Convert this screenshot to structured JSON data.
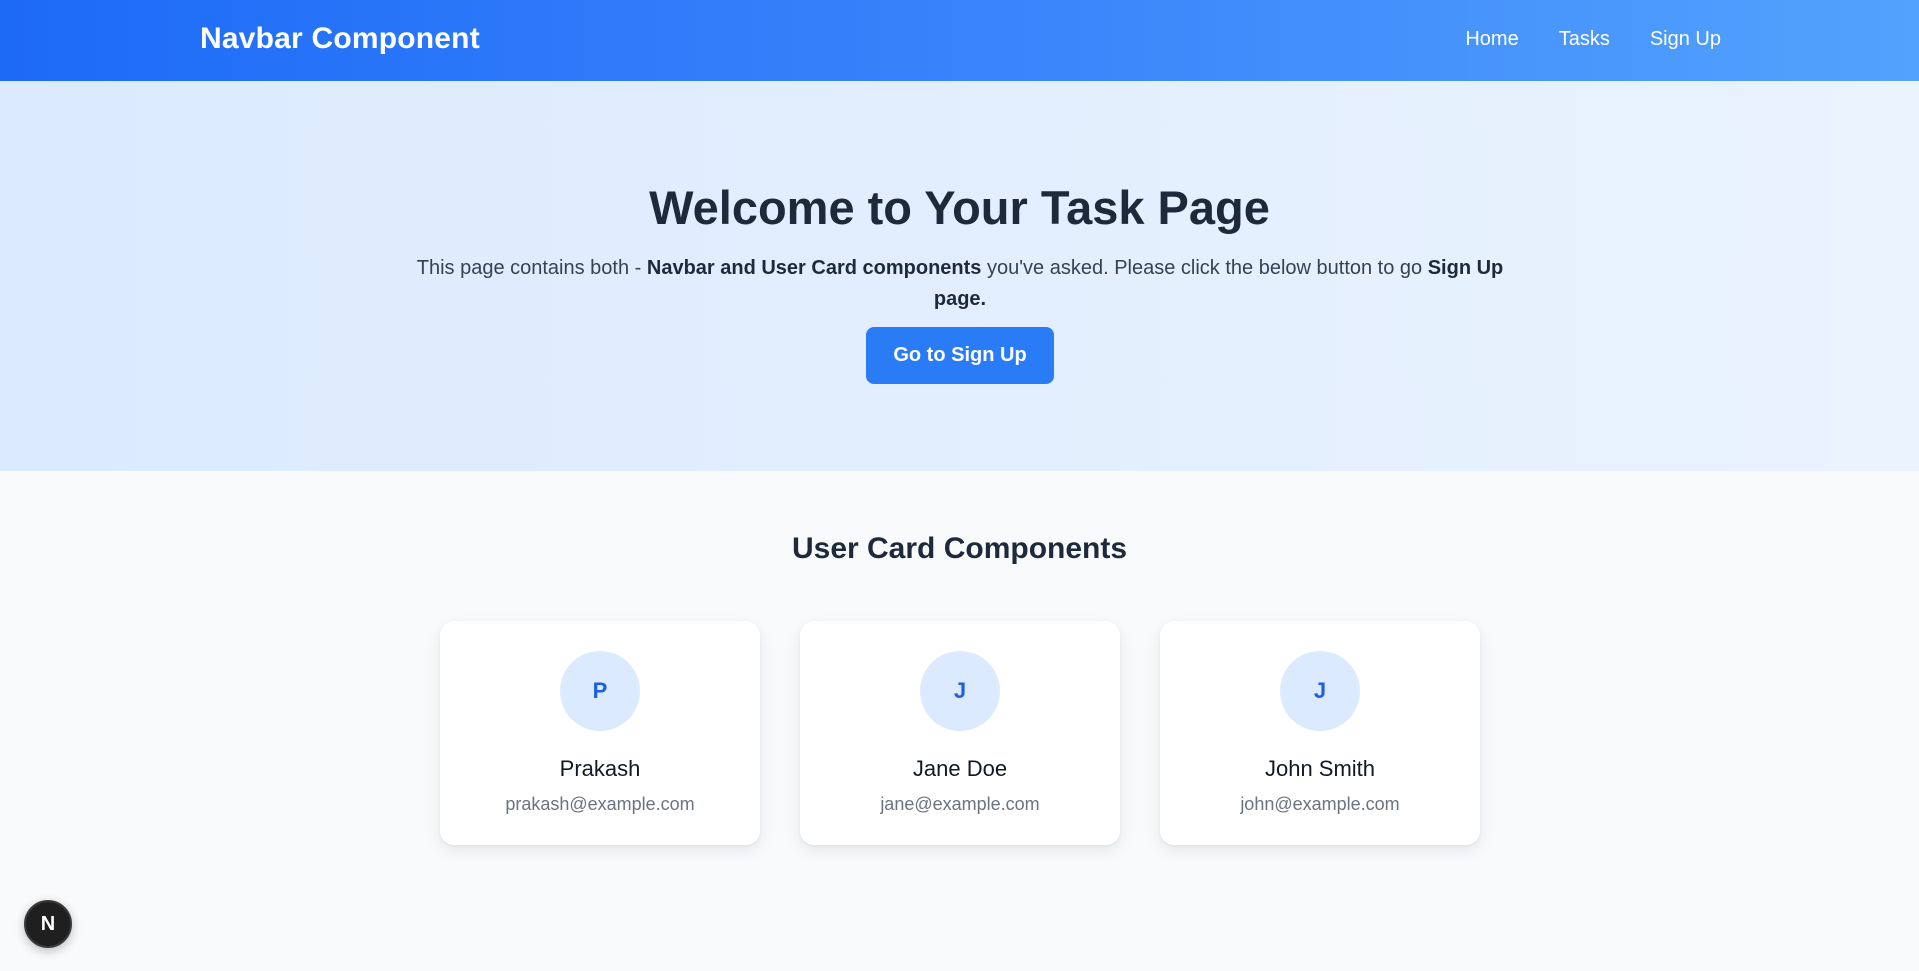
{
  "navbar": {
    "brand": "Navbar Component",
    "links": [
      "Home",
      "Tasks",
      "Sign Up"
    ]
  },
  "hero": {
    "title": "Welcome to Your Task Page",
    "text_part1": "This page contains both - ",
    "text_bold1": "Navbar and User Card components",
    "text_part2": " you've asked. Please click the below button to go ",
    "text_bold2": "Sign Up page.",
    "button_label": "Go to Sign Up"
  },
  "users_section": {
    "title": "User Card Components",
    "cards": [
      {
        "initial": "P",
        "name": "Prakash",
        "email": "prakash@example.com"
      },
      {
        "initial": "J",
        "name": "Jane Doe",
        "email": "jane@example.com"
      },
      {
        "initial": "J",
        "name": "John Smith",
        "email": "john@example.com"
      }
    ]
  },
  "dev_badge": {
    "label": "N",
    "icon": "nextjs-logo-icon"
  },
  "colors": {
    "navbar_start": "#1d6af7",
    "navbar_end": "#53a2fd",
    "hero_bg": "#dbeafe",
    "button": "#2a7cf6",
    "avatar_bg": "#dbeafe",
    "avatar_text": "#1d5fe0"
  }
}
